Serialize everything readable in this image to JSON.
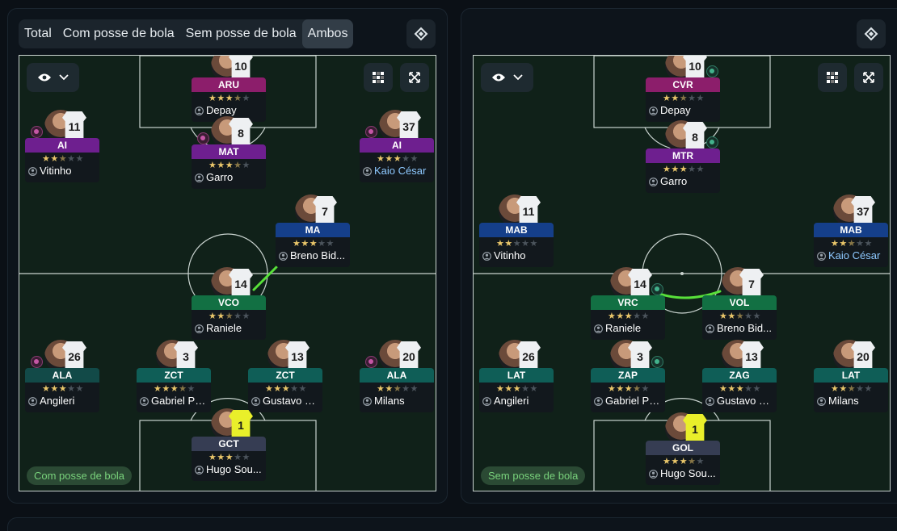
{
  "toolbar": {
    "tabs": [
      "Total",
      "Com posse de bola",
      "Sem posse de bola",
      "Ambos"
    ],
    "active_tab": "Ambos"
  },
  "colors": {
    "role_purple": "#6e1f8f",
    "role_magenta": "#8c1e6b",
    "role_blue": "#153f8a",
    "role_green": "#127043",
    "role_teal": "#0f5e57",
    "role_teal_dark": "#124a48",
    "role_gk": "#363d53",
    "star_on": "#e9c66a",
    "link_line": "#58e03a",
    "pill_text": "#79d27c"
  },
  "icons": [
    "eye-icon",
    "chevron-down-icon",
    "grid-icon",
    "expand-icon",
    "fullscreen-icon",
    "person-icon",
    "stamina-badge-icon"
  ],
  "panels": [
    {
      "mode_label": "Com posse de bola",
      "players": [
        {
          "number": "10",
          "role": "ARU",
          "color": "#8c1e6b",
          "stars": 3.5,
          "name": "Depay",
          "badge": ""
        },
        {
          "number": "11",
          "role": "AI",
          "color": "#6e1f8f",
          "stars": 2.5,
          "name": "Vitinho",
          "badge": "magenta"
        },
        {
          "number": "8",
          "role": "MAT",
          "color": "#6e1f8f",
          "stars": 3.5,
          "name": "Garro",
          "badge": "magenta"
        },
        {
          "number": "37",
          "role": "AI",
          "color": "#6e1f8f",
          "stars": 3,
          "name": "Kaio César",
          "badge": "magenta",
          "linked": true
        },
        {
          "number": "7",
          "role": "MA",
          "color": "#153f8a",
          "stars": 3,
          "name": "Breno Bid...",
          "badge": ""
        },
        {
          "number": "14",
          "role": "VCO",
          "color": "#127043",
          "stars": 2.5,
          "name": "Raniele",
          "badge": ""
        },
        {
          "number": "26",
          "role": "ALA",
          "color": "#124a48",
          "stars": 3,
          "name": "Angileri",
          "badge": "magenta"
        },
        {
          "number": "3",
          "role": "ZCT",
          "color": "#0f5e57",
          "stars": 3.5,
          "name": "Gabriel Pa...",
          "badge": ""
        },
        {
          "number": "13",
          "role": "ZCT",
          "color": "#0f5e57",
          "stars": 3,
          "name": "Gustavo H...",
          "badge": ""
        },
        {
          "number": "20",
          "role": "ALA",
          "color": "#0f5e57",
          "stars": 2.5,
          "name": "Milans",
          "badge": "magenta"
        },
        {
          "number": "1",
          "role": "GCT",
          "color": "#363d53",
          "stars": 3,
          "name": "Hugo Sou...",
          "badge": "",
          "gk": true
        }
      ]
    },
    {
      "mode_label": "Sem posse de bola",
      "players": [
        {
          "number": "10",
          "role": "CVR",
          "color": "#8c1e6b",
          "stars": 2.5,
          "name": "Depay",
          "badge": "teal"
        },
        {
          "number": "8",
          "role": "MTR",
          "color": "#6e1f8f",
          "stars": 3,
          "name": "Garro",
          "badge": "teal"
        },
        {
          "number": "11",
          "role": "MAB",
          "color": "#153f8a",
          "stars": 2,
          "name": "Vitinho",
          "badge": ""
        },
        {
          "number": "37",
          "role": "MAB",
          "color": "#153f8a",
          "stars": 2.5,
          "name": "Kaio César",
          "badge": "",
          "linked": true
        },
        {
          "number": "14",
          "role": "VRC",
          "color": "#127043",
          "stars": 3,
          "name": "Raniele",
          "badge": "teal"
        },
        {
          "number": "7",
          "role": "VOL",
          "color": "#127043",
          "stars": 2.5,
          "name": "Breno Bid...",
          "badge": ""
        },
        {
          "number": "26",
          "role": "LAT",
          "color": "#0f5e57",
          "stars": 3,
          "name": "Angileri",
          "badge": ""
        },
        {
          "number": "3",
          "role": "ZAP",
          "color": "#0f5e57",
          "stars": 3.5,
          "name": "Gabriel Pa...",
          "badge": "teal"
        },
        {
          "number": "13",
          "role": "ZAG",
          "color": "#0f5e57",
          "stars": 3,
          "name": "Gustavo H...",
          "badge": ""
        },
        {
          "number": "20",
          "role": "LAT",
          "color": "#0f5e57",
          "stars": 2.5,
          "name": "Milans",
          "badge": ""
        },
        {
          "number": "1",
          "role": "GOL",
          "color": "#363d53",
          "stars": 3.5,
          "name": "Hugo Sou...",
          "badge": "",
          "gk": true
        }
      ]
    }
  ]
}
